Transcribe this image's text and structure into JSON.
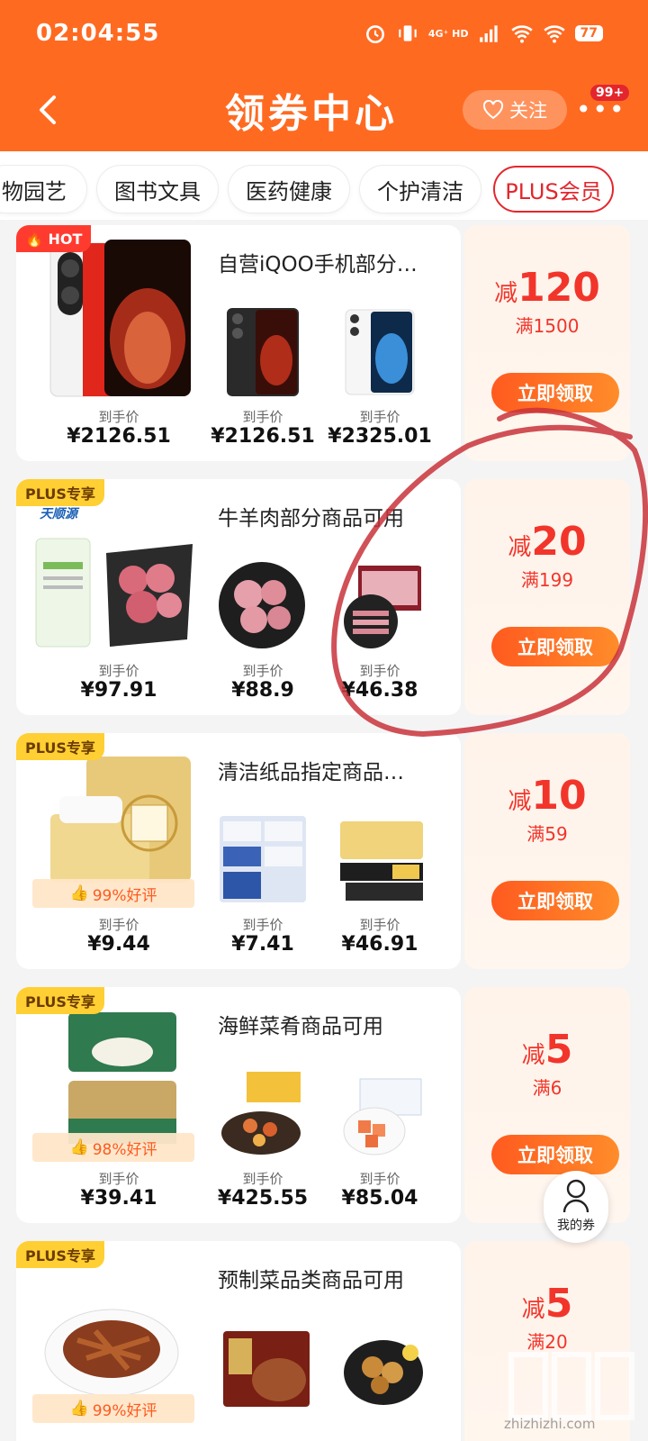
{
  "status": {
    "time": "02:04:55",
    "network": "4G⁺ HD",
    "battery": "77"
  },
  "nav": {
    "title": "领券中心",
    "follow_label": "关注",
    "more_badge": "99+"
  },
  "categories": [
    "物园艺",
    "图书文具",
    "医药健康",
    "个护清洁",
    "PLUS会员"
  ],
  "active_category": "PLUS会员",
  "price_prefix_label": "到手价",
  "claim_label": "立即领取",
  "coupons": [
    {
      "tag": "HOT",
      "title": "自营iQOO手机部分…",
      "discount_prefix": "减",
      "discount": "120",
      "condition": "满1500",
      "prices": [
        "¥2126.51",
        "¥2126.51",
        "¥2325.01"
      ],
      "rating": ""
    },
    {
      "tag": "PLUS专享",
      "title": "牛羊肉部分商品可用",
      "discount_prefix": "减",
      "discount": "20",
      "condition": "满199",
      "prices": [
        "¥97.91",
        "¥88.9",
        "¥46.38"
      ],
      "rating": "",
      "brand": "天顺源"
    },
    {
      "tag": "PLUS专享",
      "title": "清洁纸品指定商品…",
      "discount_prefix": "减",
      "discount": "10",
      "condition": "满59",
      "prices": [
        "¥9.44",
        "¥7.41",
        "¥46.91"
      ],
      "rating": "99%好评"
    },
    {
      "tag": "PLUS专享",
      "title": "海鲜菜肴商品可用",
      "discount_prefix": "减",
      "discount": "5",
      "condition": "满6",
      "prices": [
        "¥39.41",
        "¥425.55",
        "¥85.04"
      ],
      "rating": "98%好评"
    },
    {
      "tag": "PLUS专享",
      "title": "预制菜品类商品可用",
      "discount_prefix": "减",
      "discount": "5",
      "condition": "满20",
      "prices": [],
      "rating": "99%好评"
    }
  ],
  "float": {
    "my_coupons": "我的券"
  },
  "watermark": {
    "site": "zhizhizhi.com"
  },
  "colors": {
    "header": "#ff6a21",
    "accent_red": "#f2352b",
    "plus_tag": "#ffcf33",
    "hot_tag": "#ff3b30"
  }
}
